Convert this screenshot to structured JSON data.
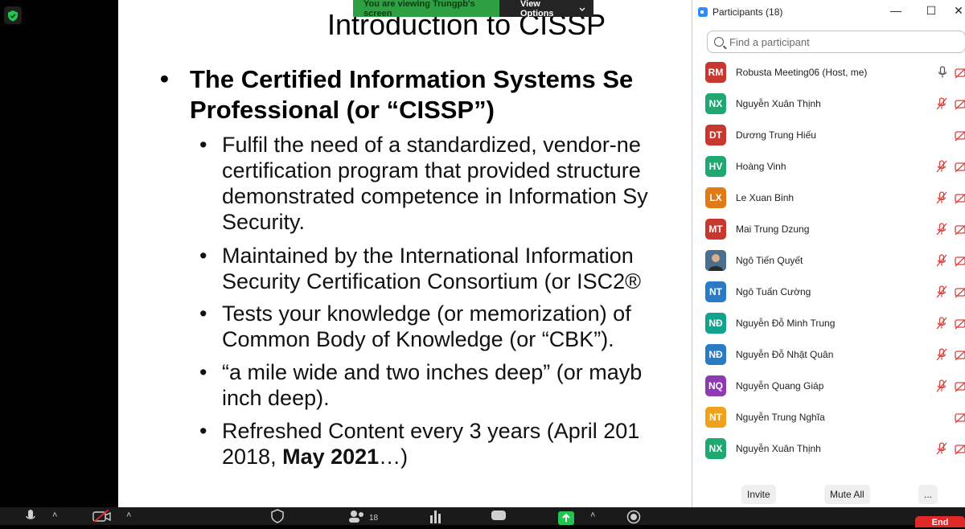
{
  "share_banner": {
    "viewing_text": "You are viewing Trungpb's screen",
    "view_options": "View Options"
  },
  "slide": {
    "title": "Introduction to CISSP",
    "bullet_main": [
      "The Certified Information Systems Se",
      "Professional (or “CISSP”)"
    ],
    "sub_bullets": [
      [
        "Fulfil the need of a standardized, vendor-ne",
        "certification program that provided structure",
        "demonstrated competence in Information Sy",
        "Security."
      ],
      [
        "Maintained by the International Information",
        "Security Certification Consortium (or ISC2®"
      ],
      [
        "Tests your knowledge (or memorization) of",
        "Common Body of Knowledge (or “CBK”)."
      ],
      [
        "“a mile wide and two inches deep”  (or mayb",
        "inch deep)."
      ]
    ],
    "last_bullet": {
      "line1": "Refreshed Content every 3 years (April 201",
      "line2_prefix": "2018, ",
      "line2_bold": "May 2021",
      "line2_suffix": "…)"
    }
  },
  "panel": {
    "title": "Participants (18)",
    "search_placeholder": "Find a participant",
    "participants": [
      {
        "initials": "RM",
        "name": "Robusta Meeting06 (Host, me)",
        "color": "#c8382e",
        "mic": "on",
        "cam": "off"
      },
      {
        "initials": "NX",
        "name": "Nguyễn Xuân Thịnh",
        "color": "#1fa971",
        "mic": "off",
        "cam": "off"
      },
      {
        "initials": "DT",
        "name": "Dương Trung Hiếu",
        "color": "#c8382e",
        "mic": "none",
        "cam": "off"
      },
      {
        "initials": "HV",
        "name": "Hoàng Vinh",
        "color": "#1fa971",
        "mic": "off",
        "cam": "off"
      },
      {
        "initials": "LX",
        "name": "Le Xuan Binh",
        "color": "#e07a16",
        "mic": "off",
        "cam": "off"
      },
      {
        "initials": "MT",
        "name": "Mai Trung Dzung",
        "color": "#c8382e",
        "mic": "off",
        "cam": "off"
      },
      {
        "initials": "",
        "name": "Ngô Tiến Quyết",
        "color": "#3b5a7a",
        "mic": "off",
        "cam": "off",
        "photo": true
      },
      {
        "initials": "NT",
        "name": "Ngô Tuấn Cường",
        "color": "#2b7bc4",
        "mic": "off",
        "cam": "off"
      },
      {
        "initials": "NĐ",
        "name": "Nguyễn Đỗ Minh Trung",
        "color": "#12a38c",
        "mic": "off",
        "cam": "off"
      },
      {
        "initials": "NĐ",
        "name": "Nguyễn Đỗ Nhật Quân",
        "color": "#2b7bc4",
        "mic": "off",
        "cam": "off"
      },
      {
        "initials": "NQ",
        "name": "Nguyễn Quang Giáp",
        "color": "#8e3bb3",
        "mic": "off",
        "cam": "off"
      },
      {
        "initials": "NT",
        "name": "Nguyễn Trung Nghĩa",
        "color": "#f0a21a",
        "mic": "none",
        "cam": "off"
      },
      {
        "initials": "NX",
        "name": "Nguyễn Xuân Thịnh",
        "color": "#1fa971",
        "mic": "off",
        "cam": "off"
      }
    ],
    "footer": {
      "invite": "Invite",
      "mute_all": "Mute All",
      "more": "..."
    }
  },
  "toolbar": {
    "participants_count": "18",
    "end_label": "End"
  },
  "colors": {
    "muted_red": "#d9403a",
    "share_green": "#2ea043",
    "zoom_blue": "#2d8cff"
  }
}
